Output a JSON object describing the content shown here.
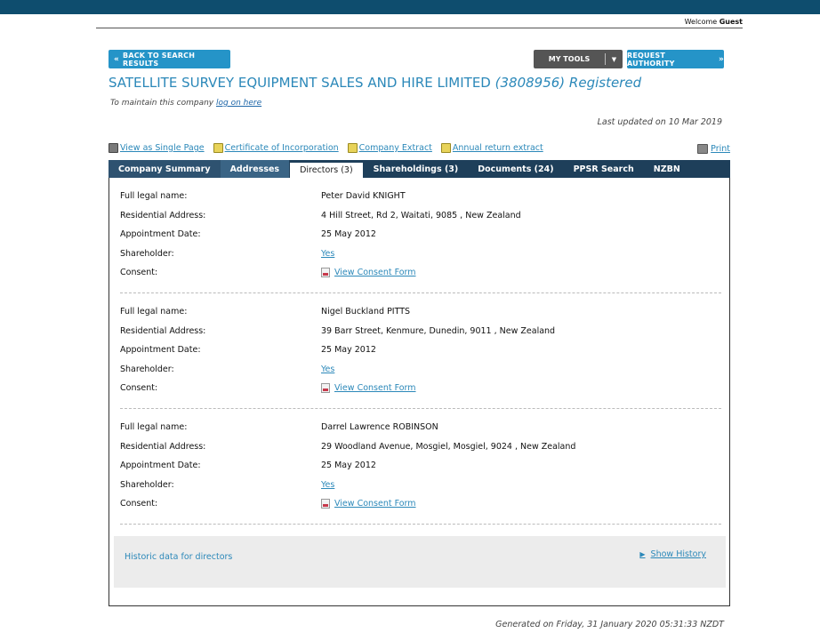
{
  "header": {
    "welcome_prefix": "Welcome",
    "welcome_user": "Guest"
  },
  "toolbar": {
    "back_label": "BACK TO SEARCH RESULTS",
    "my_tools_label": "MY TOOLS",
    "request_authority_label": "REQUEST AUTHORITY"
  },
  "company": {
    "name": "SATELLITE SURVEY EQUIPMENT SALES AND HIRE LIMITED",
    "number_status": "(3808956) Registered",
    "maintain_prefix": "To maintain this company",
    "maintain_link": "log on here",
    "last_updated": "Last updated on 10 Mar 2019"
  },
  "links": {
    "single_page": "View as Single Page",
    "certificate": "Certificate of Incorporation",
    "extract": "Company Extract",
    "annual_return": "Annual return extract",
    "print": "Print"
  },
  "tabs": [
    {
      "label": "Company Summary"
    },
    {
      "label": "Addresses"
    },
    {
      "label": "Directors (3)"
    },
    {
      "label": "Shareholdings (3)"
    },
    {
      "label": "Documents (24)"
    },
    {
      "label": "PPSR Search"
    },
    {
      "label": "NZBN"
    }
  ],
  "field_labels": {
    "full_name": "Full legal name:",
    "address": "Residential Address:",
    "appointment": "Appointment Date:",
    "shareholder": "Shareholder:",
    "consent": "Consent:"
  },
  "directors": [
    {
      "full_name": "Peter David KNIGHT",
      "address": "4 Hill Street, Rd 2, Waitati, 9085 , New Zealand",
      "appointment_date": "25 May 2012",
      "shareholder": "Yes",
      "consent": "View Consent Form"
    },
    {
      "full_name": "Nigel Buckland PITTS",
      "address": "39 Barr Street, Kenmure, Dunedin, 9011 , New Zealand",
      "appointment_date": "25 May 2012",
      "shareholder": "Yes",
      "consent": "View Consent Form"
    },
    {
      "full_name": "Darrel Lawrence ROBINSON",
      "address": "29 Woodland Avenue, Mosgiel, Mosgiel, 9024 , New Zealand",
      "appointment_date": "25 May 2012",
      "shareholder": "Yes",
      "consent": "View Consent Form"
    }
  ],
  "historic": {
    "label": "Historic data for directors",
    "show_history": "Show History"
  },
  "footer": {
    "generated": "Generated on Friday, 31 January 2020 05:31:33 NZDT"
  }
}
